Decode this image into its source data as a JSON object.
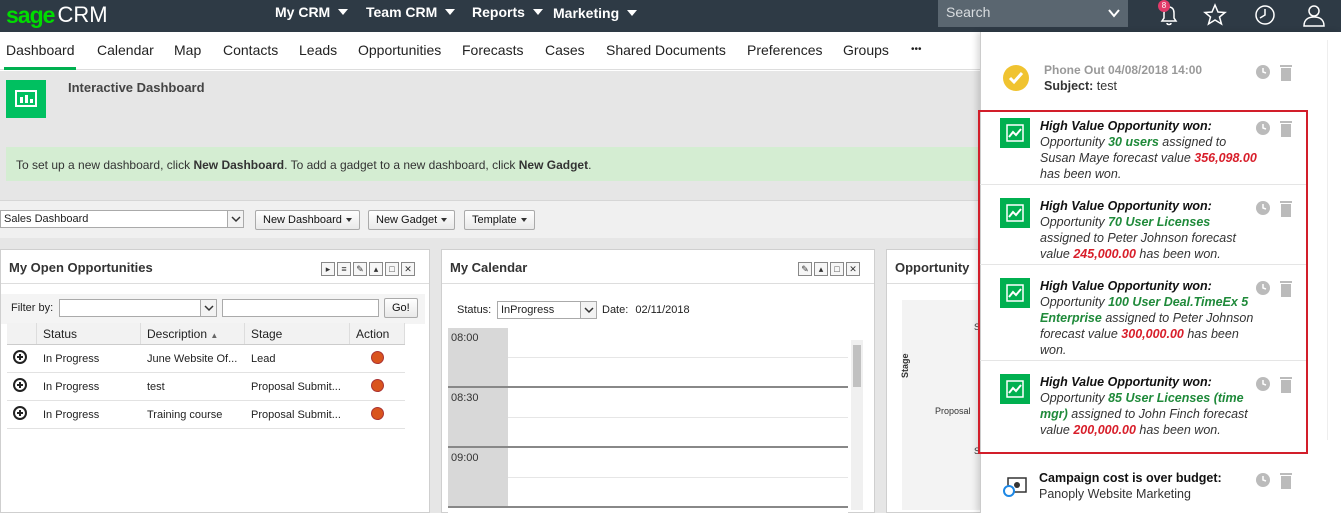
{
  "brand": {
    "sage": "sage",
    "crm": "CRM",
    "color": "#00dc00"
  },
  "topmenu": [
    {
      "label": "My CRM"
    },
    {
      "label": "Team CRM"
    },
    {
      "label": "Reports"
    },
    {
      "label": "Marketing"
    }
  ],
  "search": {
    "placeholder": "Search"
  },
  "notifications_badge": "8",
  "nav": [
    "Dashboard",
    "Calendar",
    "Map",
    "Contacts",
    "Leads",
    "Opportunities",
    "Forecasts",
    "Cases",
    "Shared Documents",
    "Preferences",
    "Groups",
    "•••"
  ],
  "dashboard": {
    "title": "Interactive Dashboard",
    "info": {
      "p1": "To set up a new dashboard, click ",
      "b1": "New Dashboard",
      "p2": ". To add a gadget to a new dashboard, click ",
      "b2": "New Gadget",
      "p3": "."
    },
    "selector": "Sales Dashboard",
    "buttons": {
      "new_dashboard": "New Dashboard",
      "new_gadget": "New Gadget",
      "template": "Template"
    }
  },
  "opportunities": {
    "title": "My Open Opportunities",
    "filter_label": "Filter by:",
    "go": "Go!",
    "columns": [
      "Status",
      "Description",
      "Stage",
      "Action"
    ],
    "rows": [
      {
        "status": "In Progress",
        "description": "June Website Of...",
        "stage": "Lead"
      },
      {
        "status": "In Progress",
        "description": "test",
        "stage": "Proposal Submit..."
      },
      {
        "status": "In Progress",
        "description": "Training course",
        "stage": "Proposal Submit..."
      }
    ]
  },
  "calendar": {
    "title": "My Calendar",
    "status_label": "Status:",
    "status_value": "InProgress",
    "date_label": "Date:",
    "date_value": "02/11/2018",
    "hours": [
      "08:00",
      "08:30",
      "09:00"
    ]
  },
  "opportunity_gadget": {
    "title": "Opportunity",
    "axis_label": "Stage",
    "tick_s1": "S",
    "tick_proposal": "Proposal",
    "tick_s2": "S"
  },
  "notifications": {
    "phone": {
      "title": "Phone Out",
      "datetime": "04/08/2018 14:00",
      "subject_label": "Subject:",
      "subject_value": "test"
    },
    "won": [
      {
        "head": "High Value Opportunity won:",
        "pre": "Opportunity ",
        "name": "30 users",
        "mid": " assigned to Susan Maye forecast value ",
        "value": "356,098.00",
        "post": " has been won."
      },
      {
        "head": "High Value Opportunity won:",
        "pre": "Opportunity ",
        "name": "70 User Licenses",
        "mid": " assigned to Peter Johnson forecast value ",
        "value": "245,000.00",
        "post": " has been won."
      },
      {
        "head": "High Value Opportunity won:",
        "pre": "Opportunity ",
        "name": "100 User Deal.TimeEx 5 Enterprise",
        "mid": " assigned to Peter Johnson forecast value ",
        "value": "300,000.00",
        "post": " has been won."
      },
      {
        "head": "High Value Opportunity won:",
        "pre": "Opportunity ",
        "name": "85 User Licenses (time mgr)",
        "mid": " assigned to John Finch forecast value ",
        "value": "200,000.00",
        "post": " has been won."
      }
    ],
    "campaign": {
      "head": "Campaign cost is over budget:",
      "body": "Panoply Website Marketing"
    }
  },
  "colors": {
    "accent": "#00b050",
    "highlight": "#d21e2a",
    "topbar": "#2e3a45"
  }
}
